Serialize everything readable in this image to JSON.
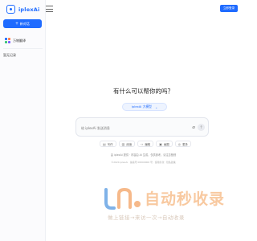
{
  "app": {
    "name": "iplexAi"
  },
  "sidebar": {
    "new_chat_label": "新对话",
    "items": [
      {
        "label": "万物翻译"
      }
    ],
    "section_label": "暂无记录"
  },
  "topbar": {
    "action_label": "立即登录"
  },
  "main": {
    "greeting": "有什么可以帮你的吗？",
    "model_selected": "iplexAi 大模型",
    "input_placeholder": "给 iplexAi 发送消息",
    "tools": [
      {
        "icon": "doc-icon",
        "label": "写作"
      },
      {
        "icon": "reading-icon",
        "label": "阅读"
      },
      {
        "icon": "code-icon",
        "label": "编程"
      },
      {
        "icon": "image-icon",
        "label": "画图"
      },
      {
        "icon": "more-icon",
        "label": "更多"
      }
    ],
    "hint_line_1": "由 iplexAi 提供 · 内容由 AI 生成，仅供参考，请注意甄别",
    "hint_line_2": "©2024 iplexAi · 备案号 00000000 号 · 使用条款 · 隐私政策"
  },
  "watermark": {
    "title": "自动秒收录",
    "subtitle": "做上链接→来访一次→自动收录"
  },
  "colors": {
    "accent": "#1f6bff",
    "watermark": "#f8c9a0"
  }
}
